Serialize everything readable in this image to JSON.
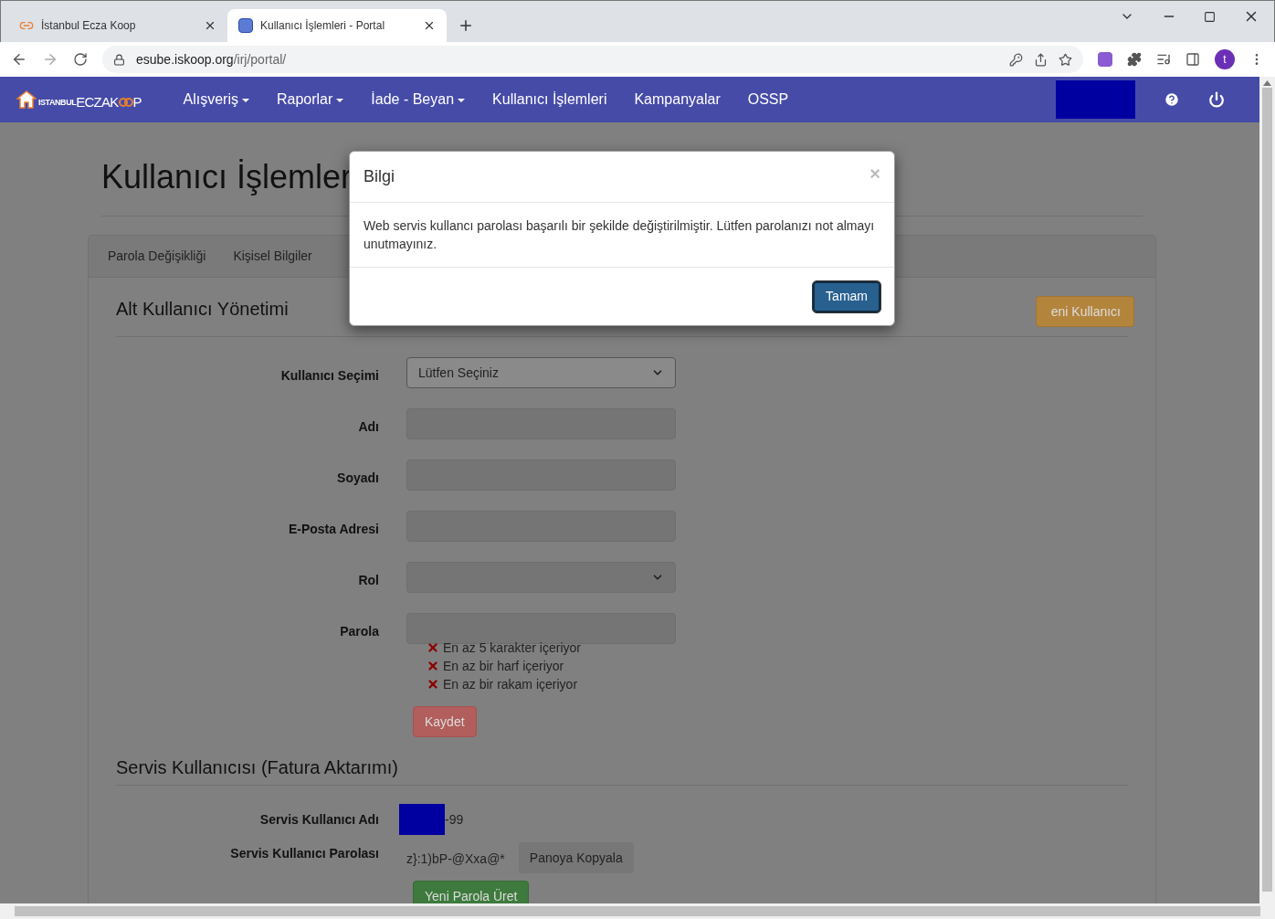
{
  "browser": {
    "tabs": [
      {
        "title": "İstanbul Ecza Koop",
        "selected": false
      },
      {
        "title": "Kullanıcı İşlemleri - Portal",
        "selected": true
      }
    ],
    "address": {
      "host": "esube.iskoop.org",
      "path": "/irj/portal/"
    },
    "profile": "t"
  },
  "nav": {
    "logo": {
      "small": "ISTANBUL",
      "main": "ECZAK",
      "end": "P"
    },
    "menu": [
      {
        "label": "Alışveriş",
        "dropdown": true
      },
      {
        "label": "Raporlar",
        "dropdown": true
      },
      {
        "label": "İade - Beyan",
        "dropdown": true
      },
      {
        "label": "Kullanıcı İşlemleri",
        "dropdown": false
      },
      {
        "label": "Kampanyalar",
        "dropdown": false
      },
      {
        "label": "OSSP",
        "dropdown": false
      }
    ]
  },
  "page": {
    "title": "Kullanıcı İşlemler",
    "panel_tabs": [
      "Parola Değişikliği",
      "Kişisel Bilgiler"
    ],
    "sub_users": {
      "heading": "Alt Kullanıcı Yönetimi",
      "new_button": "eni Kullanıcı",
      "fields": [
        {
          "label": "Kullanıcı Seçimi",
          "kind": "select",
          "value": "Lütfen Seçiniz",
          "disabled": false
        },
        {
          "label": "Adı",
          "kind": "text",
          "disabled": true
        },
        {
          "label": "Soyadı",
          "kind": "text",
          "disabled": true
        },
        {
          "label": "E-Posta Adresi",
          "kind": "text",
          "disabled": true
        },
        {
          "label": "Rol",
          "kind": "select",
          "disabled": true
        },
        {
          "label": "Parola",
          "kind": "text",
          "disabled": true
        }
      ],
      "rules": [
        {
          "text": "En az 5 karakter içeriyor",
          "met": false
        },
        {
          "text": "En az bir harf içeriyor",
          "met": false
        },
        {
          "text": "En az bir rakam içeriyor",
          "met": false
        }
      ],
      "save_button": "Kaydet"
    },
    "service_user": {
      "heading": "Servis Kullanıcısı (Fatura Aktarımı)",
      "name_label": "Servis Kullanıcı Adı",
      "name_suffix": "-99",
      "password_label": "Servis Kullanıcı Parolası",
      "password": "z}:1)bP-@Xxa@*",
      "copy_button": "Panoya Kopyala",
      "generate_button": "Yeni Parola Üret"
    }
  },
  "dialog": {
    "title": "Bilgi",
    "close": "×",
    "message": "Web servis kullancı parolası başarılı bir şekilde değiştirilmiştir. Lütfen parolanızı not almayı unutmayınız.",
    "ok": "Tamam"
  }
}
